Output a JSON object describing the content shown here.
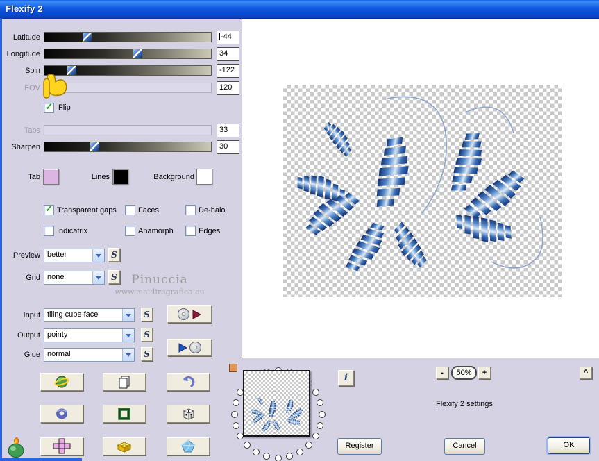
{
  "window": {
    "title": "Flexify 2"
  },
  "sliders": {
    "latitude": {
      "label": "Latitude",
      "value": "-44"
    },
    "longitude": {
      "label": "Longitude",
      "value": "34"
    },
    "spin": {
      "label": "Spin",
      "value": "-122"
    },
    "fov": {
      "label": "FOV",
      "value": "120"
    },
    "tabs": {
      "label": "Tabs",
      "value": "33"
    },
    "sharpen": {
      "label": "Sharpen",
      "value": "30"
    }
  },
  "flip_label": "Flip",
  "swatches": {
    "tab_label": "Tab",
    "lines_label": "Lines",
    "background_label": "Background",
    "tab_color": "#ddb5e2",
    "lines_color": "#000000",
    "background_color": "#ffffff"
  },
  "checkboxes": {
    "transparent_gaps": "Transparent gaps",
    "faces": "Faces",
    "dehalo": "De-halo",
    "indicatrix": "Indicatrix",
    "anamorph": "Anamorph",
    "edges": "Edges"
  },
  "combos": {
    "preview": {
      "label": "Preview",
      "value": "better"
    },
    "grid": {
      "label": "Grid",
      "value": "none"
    },
    "input": {
      "label": "Input",
      "value": "tiling cube face"
    },
    "output": {
      "label": "Output",
      "value": "pointy"
    },
    "glue": {
      "label": "Glue",
      "value": "normal"
    }
  },
  "s_button_label": "S",
  "watermark": {
    "name": "Pinuccia",
    "url": "www.maidiregrafica.eu"
  },
  "info_label": "i",
  "zoom": {
    "minus": "-",
    "value": "50%",
    "plus": "+"
  },
  "scroll_up": "^",
  "settings_text": "Flexify 2 settings",
  "buttons": {
    "register": "Register",
    "cancel": "Cancel",
    "ok": "OK"
  },
  "colors": {
    "titlebar": "#1159e0",
    "dialog_bg": "#d5d2e3",
    "accent_blue": "#4878c8"
  }
}
